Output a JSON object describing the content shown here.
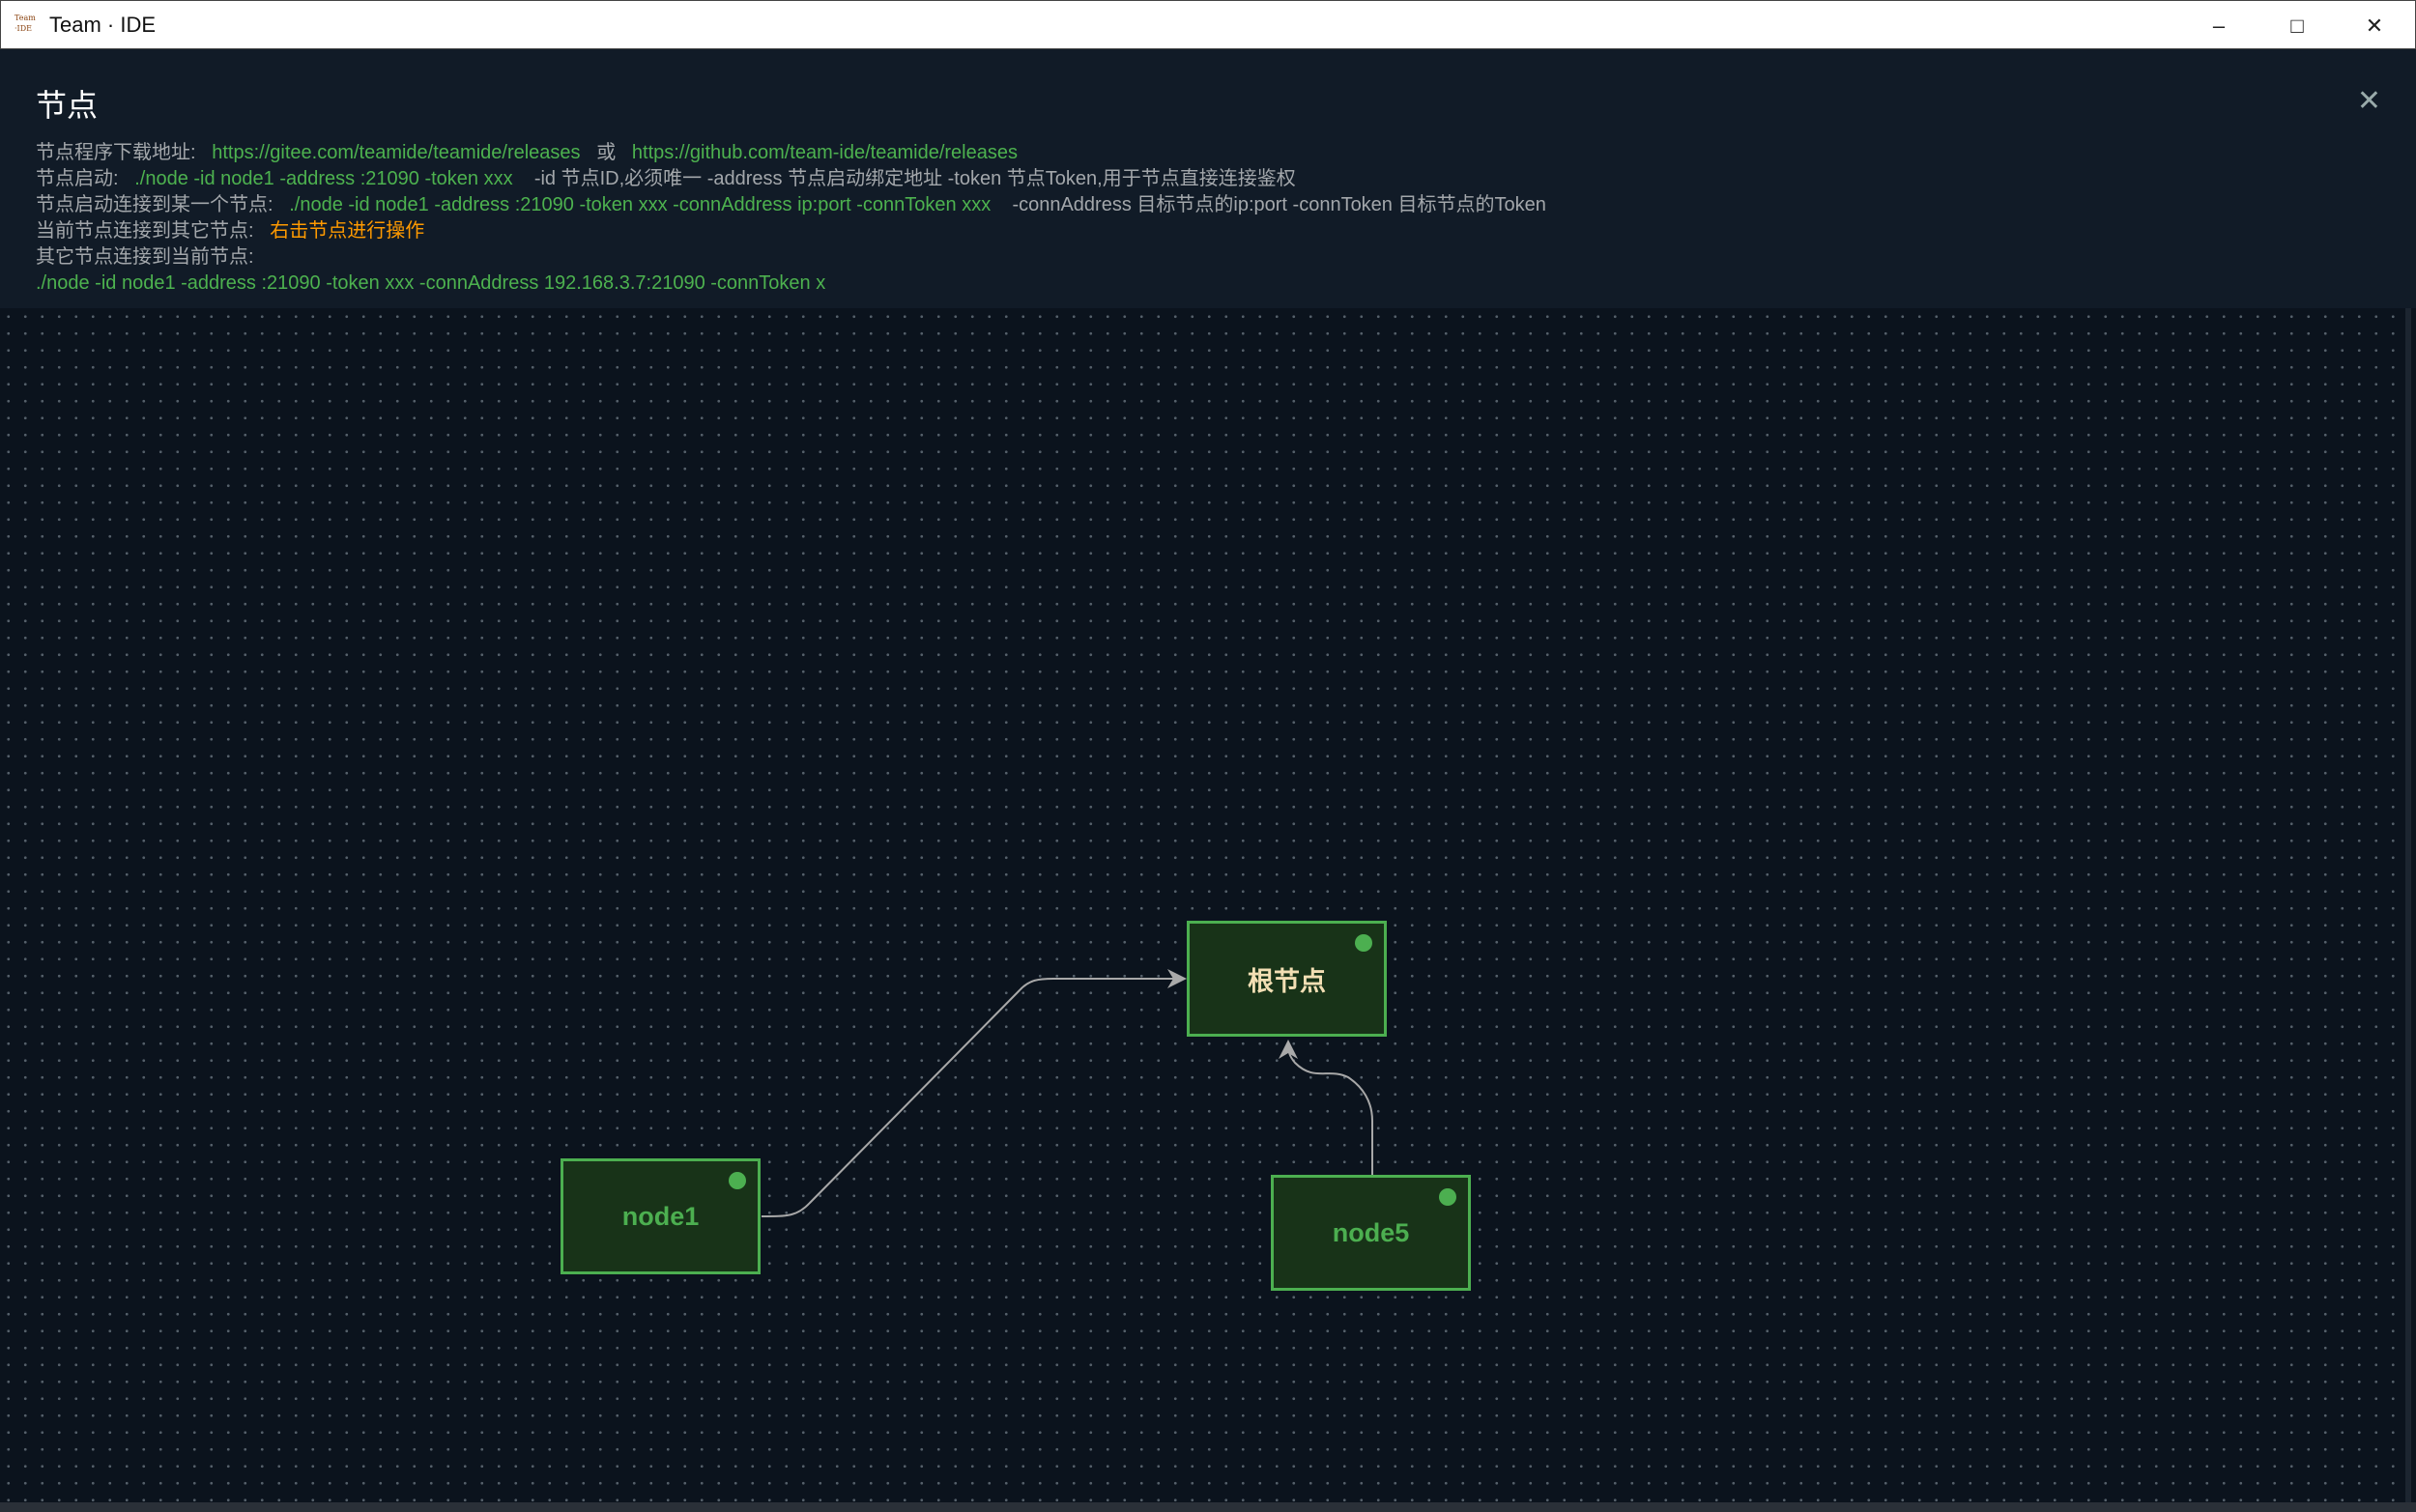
{
  "window": {
    "title": "Team · IDE",
    "logo_text": "Team IDE"
  },
  "header": {
    "title": "节点",
    "download_label": "节点程序下载地址:",
    "gitee_url": "https://gitee.com/teamide/teamide/releases",
    "or": "或",
    "github_url": "https://github.com/team-ide/teamide/releases",
    "start_label": "节点启动:",
    "start_cmd": "./node -id node1 -address :21090 -token xxx",
    "start_desc": "-id 节点ID,必须唯一 -address 节点启动绑定地址 -token 节点Token,用于节点直接连接鉴权",
    "connect_label": "节点启动连接到某一个节点:",
    "connect_cmd": "./node -id node1 -address :21090 -token xxx -connAddress ip:port -connToken xxx",
    "connect_desc": "-connAddress 目标节点的ip:port -connToken 目标节点的Token",
    "current_label": "当前节点连接到其它节点:",
    "current_hint": "右击节点进行操作",
    "other_label": "其它节点连接到当前节点:",
    "other_cmd": "./node -id node1 -address :21090 -token xxx -connAddress 192.168.3.7:21090 -connToken x"
  },
  "nodes": [
    {
      "label": "根节点",
      "status": "online"
    },
    {
      "label": "node1",
      "status": "online"
    },
    {
      "label": "node5",
      "status": "online"
    }
  ],
  "edges": [
    {
      "from": "node1",
      "to": "根节点"
    },
    {
      "from": "node5",
      "to": "根节点"
    }
  ],
  "colors": {
    "accent": "#4caf50",
    "hint": "#ff9a00",
    "node_fill": "#183318"
  }
}
